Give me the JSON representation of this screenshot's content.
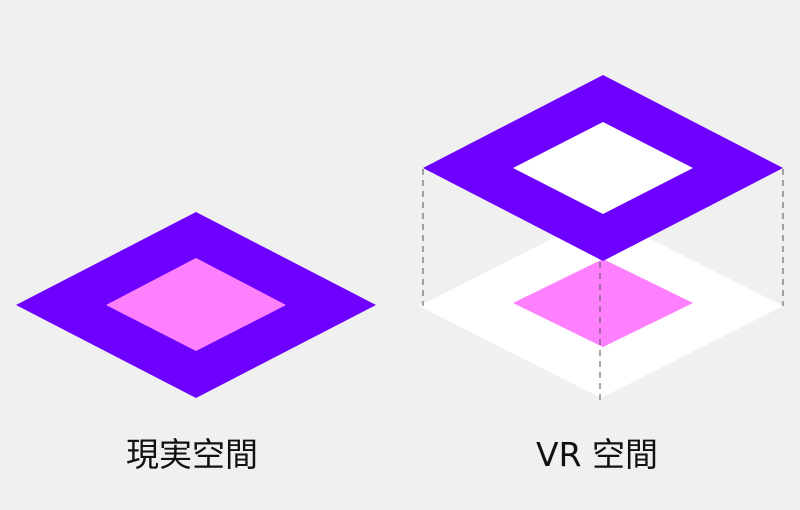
{
  "colors": {
    "background": "#f0f0f0",
    "frame": "#6e00ff",
    "inner_fill": "#ff80ff",
    "shadow_floor": "#ffffff",
    "hole": "#ffffff",
    "guide_line": "#555555"
  },
  "left_diagram": {
    "caption": "現実空間"
  },
  "right_diagram": {
    "caption": "VR 空間"
  }
}
